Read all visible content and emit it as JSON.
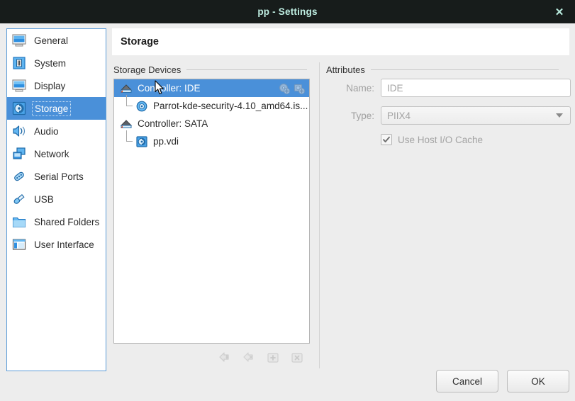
{
  "window": {
    "title": "pp - Settings",
    "close_label": "✕",
    "accent_blue": "#4a90d9",
    "titlebar_bg": "#171c1b",
    "titlebar_fg": "#bfeee2",
    "dialog_bg": "#ededed"
  },
  "sidebar": {
    "items": [
      {
        "label": "General",
        "icon": "monitor-icon",
        "selected": false
      },
      {
        "label": "System",
        "icon": "motherboard-icon",
        "selected": false
      },
      {
        "label": "Display",
        "icon": "display-icon",
        "selected": false
      },
      {
        "label": "Storage",
        "icon": "harddisk-icon",
        "selected": true
      },
      {
        "label": "Audio",
        "icon": "speaker-icon",
        "selected": false
      },
      {
        "label": "Network",
        "icon": "network-icon",
        "selected": false
      },
      {
        "label": "Serial Ports",
        "icon": "serial-port-icon",
        "selected": false
      },
      {
        "label": "USB",
        "icon": "usb-icon",
        "selected": false
      },
      {
        "label": "Shared Folders",
        "icon": "folder-icon",
        "selected": false
      },
      {
        "label": "User Interface",
        "icon": "user-interface-icon",
        "selected": false
      }
    ]
  },
  "page": {
    "title": "Storage"
  },
  "storage": {
    "devices_caption": "Storage Devices",
    "tree": [
      {
        "label": "Controller: IDE",
        "icon": "ide-controller-icon",
        "level": 0,
        "selected": true,
        "actions": [
          "add-optical-drive-icon",
          "add-hard-disk-icon"
        ]
      },
      {
        "label": "Parrot-kde-security-4.10_amd64.is...",
        "icon": "optical-disk-icon",
        "level": 1,
        "selected": false,
        "actions": []
      },
      {
        "label": "Controller: SATA",
        "icon": "sata-controller-icon",
        "level": 0,
        "selected": false,
        "actions": []
      },
      {
        "label": "pp.vdi",
        "icon": "hard-disk-icon",
        "level": 1,
        "selected": false,
        "actions": []
      }
    ],
    "toolbar": [
      {
        "name": "add-controller-button",
        "enabled": false
      },
      {
        "name": "remove-controller-button",
        "enabled": false
      },
      {
        "name": "add-attachment-button",
        "enabled": false
      },
      {
        "name": "remove-attachment-button",
        "enabled": false
      }
    ]
  },
  "attributes": {
    "caption": "Attributes",
    "name_label": "Name:",
    "name_value": "IDE",
    "type_label": "Type:",
    "type_value": "PIIX4",
    "use_host_io_cache_label": "Use Host I/O Cache",
    "use_host_io_cache_checked": true
  },
  "footer": {
    "cancel_label": "Cancel",
    "ok_label": "OK"
  }
}
